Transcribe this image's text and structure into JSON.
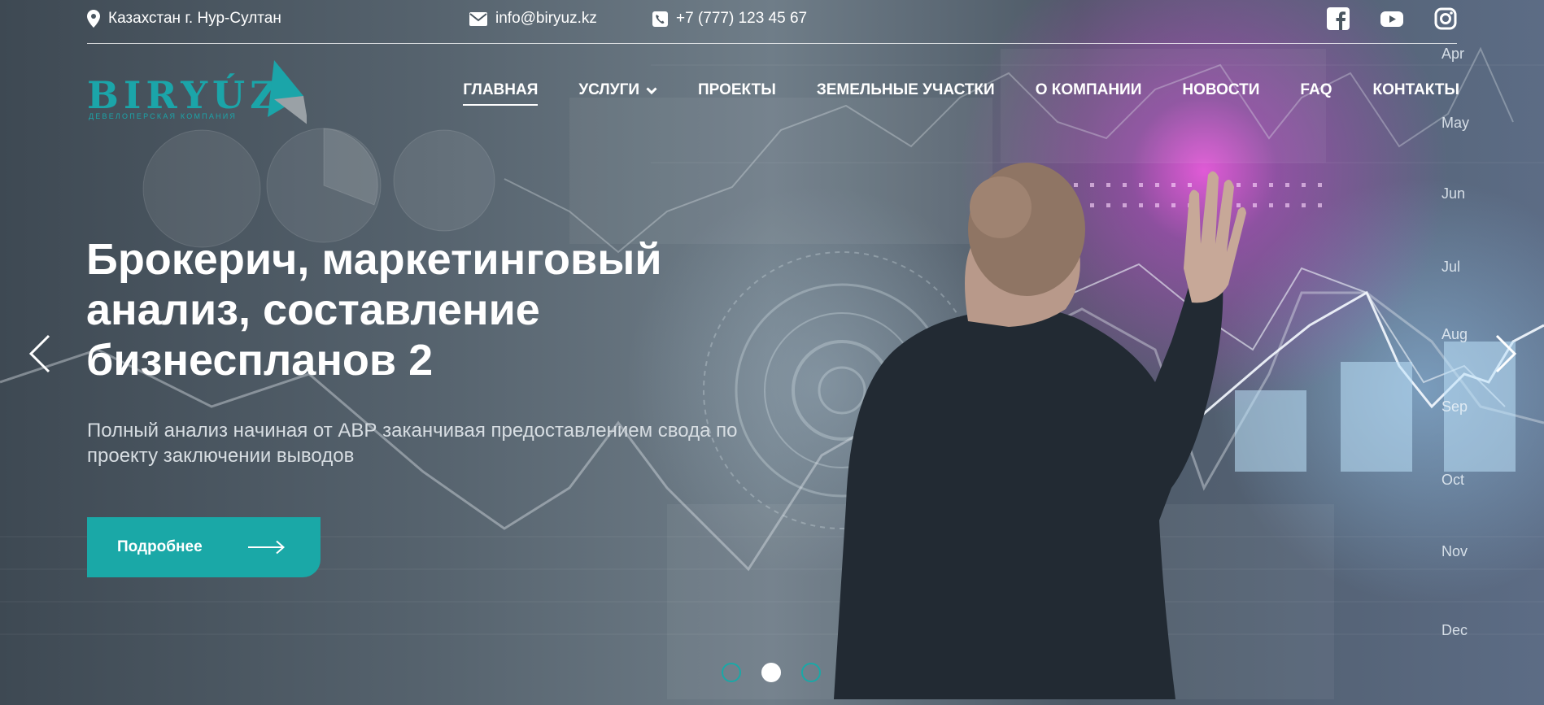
{
  "topbar": {
    "address": "Казахстан г. Нур-Султан",
    "email": "info@biryuz.kz",
    "phone": "+7 (777) 123 45 67",
    "socials": [
      "facebook-icon",
      "youtube-icon",
      "instagram-icon"
    ]
  },
  "logo": {
    "name": "BIRYÚZ",
    "tagline": "Девелоперская компания"
  },
  "nav": {
    "items": [
      {
        "label": "ГЛАВНАЯ",
        "active": true
      },
      {
        "label": "УСЛУГИ",
        "dropdown": true
      },
      {
        "label": "ПРОЕКТЫ"
      },
      {
        "label": "ЗЕМЕЛЬНЫЕ УЧАСТКИ"
      },
      {
        "label": "О КОМПАНИИ"
      },
      {
        "label": "НОВОСТИ"
      },
      {
        "label": "FAQ"
      },
      {
        "label": "КОНТАКТЫ"
      }
    ]
  },
  "hero": {
    "headline": "Брокерич, маркетинговый анализ, составление бизнеспланов 2",
    "subtitle": "Полный анализ начиная от АВР заканчивая предоставлением свода по проекту заключении выводов",
    "cta_label": "Подробнее",
    "months": [
      "Apr",
      "May",
      "Jun",
      "Jul",
      "Aug",
      "Sep",
      "Oct",
      "Nov",
      "Dec"
    ]
  },
  "slider": {
    "dot_count": 3,
    "active_dot": 2
  },
  "colors": {
    "accent": "#1aa8a7",
    "overlay": "#3d4a57"
  }
}
